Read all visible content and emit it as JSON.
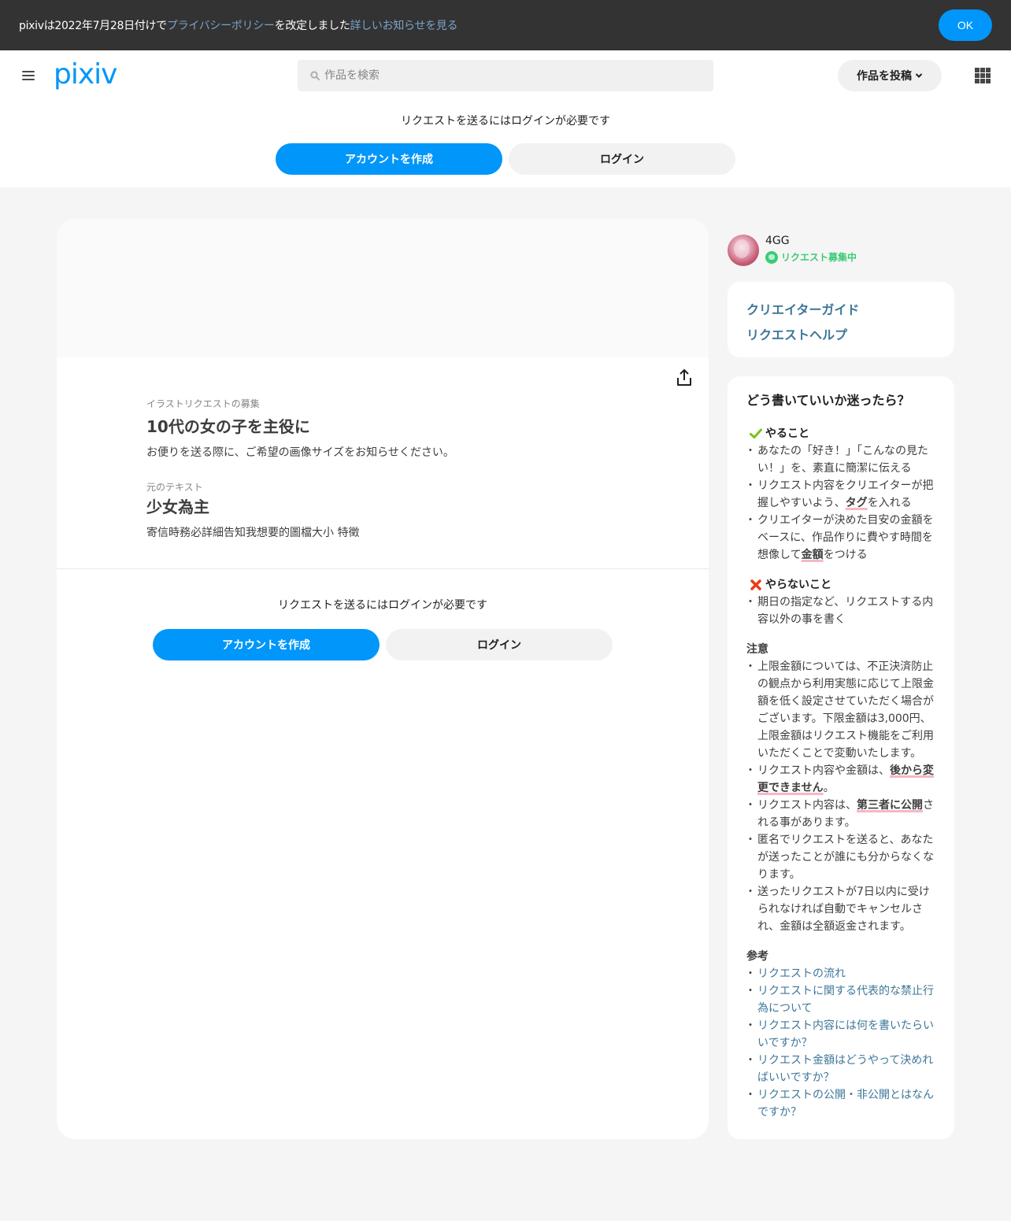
{
  "notice": {
    "text_1": "pixivは2022年7月28日付けで",
    "link_privacy": "プライバシーポリシー",
    "text_2": "を改定しました",
    "link_details": "詳しいお知らせを見る",
    "ok_label": "OK"
  },
  "header": {
    "logo": "pixiv",
    "search_placeholder": "作品を検索",
    "post_label": "作品を投稿"
  },
  "top_login": {
    "prompt": "リクエストを送るにはログインが必要です",
    "create_account": "アカウントを作成",
    "login": "ログイン"
  },
  "request": {
    "label": "イラストリクエストの募集",
    "title": "10代の女の子を主役に",
    "body": "お便りを送る際に、ご希望の画像サイズをお知らせください。",
    "original_label": "元のテキスト",
    "original_title": "少女為主",
    "original_body": "寄信時務必詳細告知我想要的圖檔大小 特徵"
  },
  "bottom_login": {
    "prompt": "リクエストを送るにはログインが必要です",
    "create_account": "アカウントを作成",
    "login": "ログイン"
  },
  "creator": {
    "name": "4GG",
    "status": "リクエスト募集中"
  },
  "links": {
    "creator_guide": "クリエイターガイド",
    "request_help": "リクエストヘルプ"
  },
  "guide": {
    "title": "どう書いていいか迷ったら？",
    "do_title": "やること",
    "do_1": "あなたの「好き！」「こんなの見たい！」を、素直に簡潔に伝える",
    "do_2a": "リクエスト内容をクリエイターが把握しやすいよう、",
    "do_2_hl": "タグ",
    "do_2b": "を入れる",
    "do_3a": "クリエイターが決めた目安の金額をベースに、作品作りに費やす時間を想像して",
    "do_3_hl": "金額",
    "do_3b": "をつける",
    "dont_title": "やらないこと",
    "dont_1": "期日の指定など、リクエストする内容以外の事を書く",
    "note_title": "注意",
    "note_1": "上限金額については、不正決済防止の観点から利用実態に応じて上限金額を低く設定させていただく場合がございます。下限金額は3,000円、上限金額はリクエスト機能をご利用いただくことで変動いたします。",
    "note_2a": "リクエスト内容や金額は、",
    "note_2_hl": "後から変更できません",
    "note_2b": "。",
    "note_3a": "リクエスト内容は、",
    "note_3_hl": "第三者に公開",
    "note_3b": "される事があります。",
    "note_4": "匿名でリクエストを送ると、あなたが送ったことが誰にも分からなくなります。",
    "note_5": "送ったリクエストが7日以内に受けられなければ自動でキャンセルされ、金額は全額返金されます。",
    "ref_title": "参考",
    "ref_1": "リクエストの流れ",
    "ref_2": "リクエストに関する代表的な禁止行為について",
    "ref_3": "リクエスト内容には何を書いたらいいですか？",
    "ref_4": "リクエスト金額はどうやって決めればいいですか？",
    "ref_5": "リクエストの公開・非公開とはなんですか？"
  },
  "colors": {
    "accent": "#0096fa",
    "link": "#3d7699",
    "status_green": "#3ccb76",
    "highlight_underline": "#f5b8c4",
    "notice_bg": "#333333"
  }
}
